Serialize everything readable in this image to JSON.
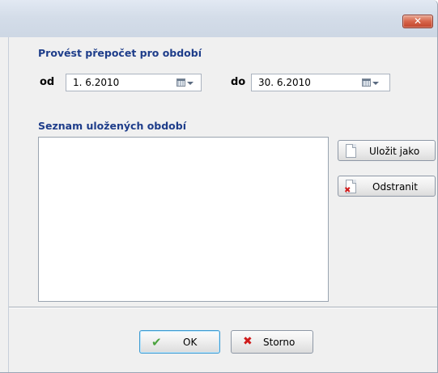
{
  "titlebar": {
    "close_glyph": "✕"
  },
  "period": {
    "title": "Provést přepočet pro období",
    "from_label": "od",
    "from_value": "1. 6.2010",
    "to_label": "do",
    "to_value": "30. 6.2010"
  },
  "saved": {
    "title": "Seznam uložených období",
    "items": [],
    "save_as_label": "Uložit jako",
    "remove_label": "Odstranit"
  },
  "footer": {
    "ok_label": "OK",
    "cancel_label": "Storno"
  },
  "icons": {
    "close": "close-icon",
    "calendar": "calendar-icon",
    "document": "document-icon",
    "document_delete": "document-delete-icon",
    "check": "check-icon",
    "cancel": "x-icon"
  },
  "colors": {
    "section_title": "#1e3d8a",
    "close_button": "#d7644a",
    "ok_check": "#4ba33e",
    "cancel_x": "#cf1b1b"
  }
}
